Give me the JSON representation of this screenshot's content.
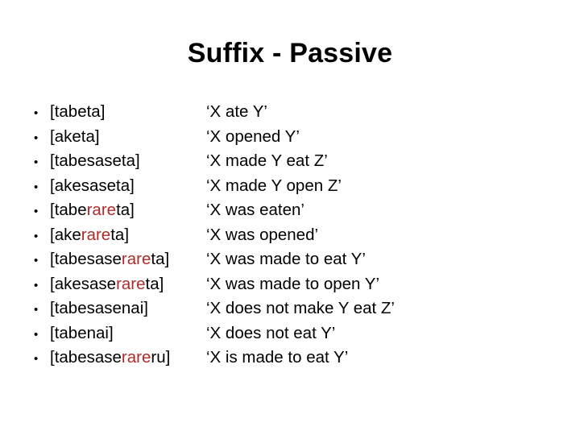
{
  "slide": {
    "title": "Suffix - Passive",
    "bullet_glyph": "•",
    "highlight_color": "#AF2B2B",
    "text_color": "#000000",
    "background_color": "#FFFFFF",
    "items": [
      {
        "form_prefix": "[tabeta]",
        "form_highlight": "",
        "form_suffix": "",
        "gloss": "‘X ate Y’"
      },
      {
        "form_prefix": "[aketa]",
        "form_highlight": "",
        "form_suffix": "",
        "gloss": "‘X opened Y’"
      },
      {
        "form_prefix": "[tabesaseta]",
        "form_highlight": "",
        "form_suffix": "",
        "gloss": "‘X made Y eat Z’"
      },
      {
        "form_prefix": "[akesaseta]",
        "form_highlight": "",
        "form_suffix": "",
        "gloss": "‘X made Y open Z’"
      },
      {
        "form_prefix": "[tabe",
        "form_highlight": "rare",
        "form_suffix": "ta]",
        "gloss": "‘X was eaten’"
      },
      {
        "form_prefix": "[ake",
        "form_highlight": "rare",
        "form_suffix": "ta]",
        "gloss": "‘X was opened’"
      },
      {
        "form_prefix": "[tabesase",
        "form_highlight": "rare",
        "form_suffix": "ta]",
        "gloss": "‘X was made to eat Y’"
      },
      {
        "form_prefix": "[akesase",
        "form_highlight": "rare",
        "form_suffix": "ta]",
        "gloss": "‘X was made to open Y’"
      },
      {
        "form_prefix": "[tabesasenai]",
        "form_highlight": "",
        "form_suffix": "",
        "gloss": "‘X does not make Y eat Z’"
      },
      {
        "form_prefix": "[tabenai]",
        "form_highlight": "",
        "form_suffix": "",
        "gloss": "‘X does not eat Y’"
      },
      {
        "form_prefix": "[tabesase",
        "form_highlight": "rare",
        "form_suffix": "ru]",
        "gloss": "‘X is made to eat Y’"
      }
    ]
  }
}
